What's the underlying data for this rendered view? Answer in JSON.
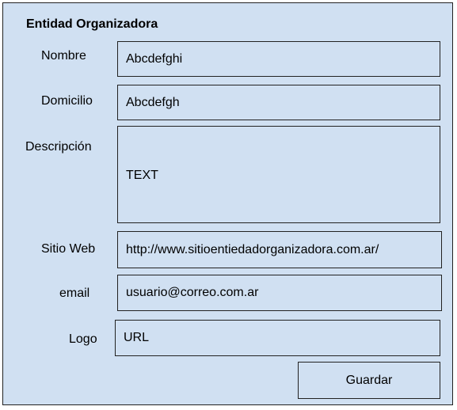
{
  "form": {
    "title": "Entidad Organizadora",
    "fields": {
      "nombre": {
        "label": "Nombre",
        "value": "Abcdefghi"
      },
      "domicilio": {
        "label": "Domicilio",
        "value": "Abcdefgh"
      },
      "descripcion": {
        "label": "Descripción",
        "value": "TEXT"
      },
      "sitio_web": {
        "label": "Sitio Web",
        "value": "http://www.sitioentiedadorganizadora.com.ar/"
      },
      "email": {
        "label": "email",
        "value": "usuario@correo.com.ar"
      },
      "logo": {
        "label": "Logo",
        "value": "URL"
      }
    },
    "save_label": "Guardar"
  },
  "colors": {
    "panel_background": "#d0e0f2",
    "border": "#222222"
  }
}
